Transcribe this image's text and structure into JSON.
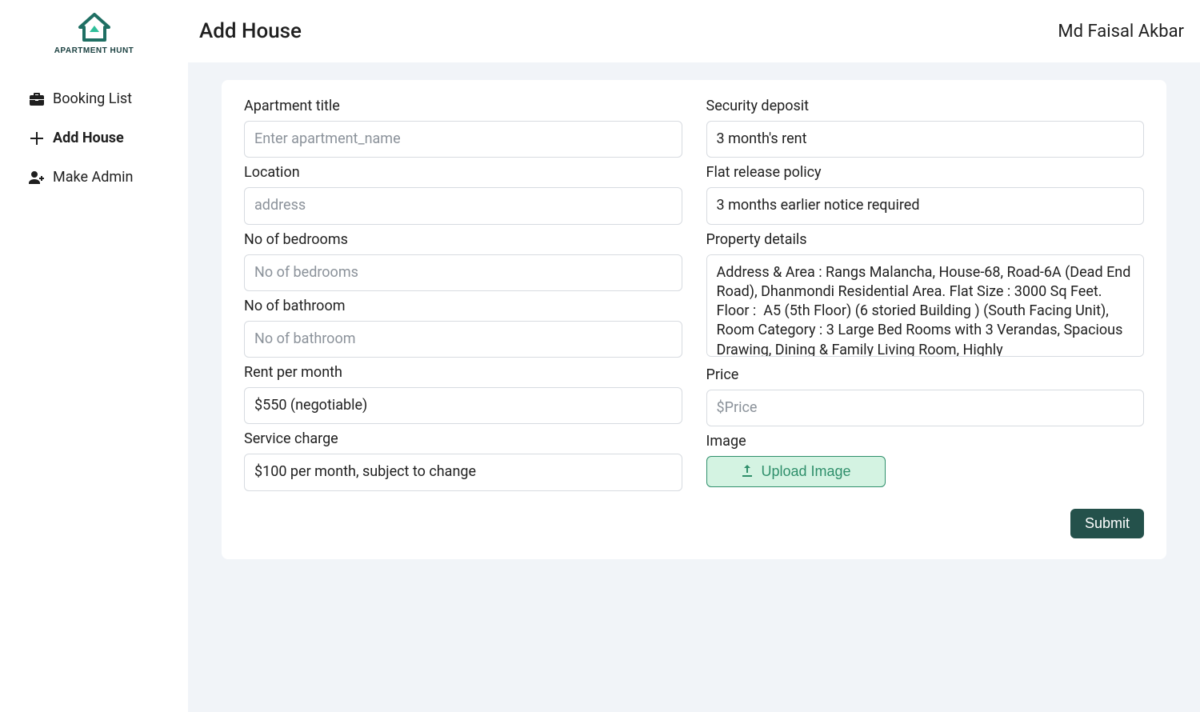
{
  "brand": {
    "name": "APARTMENT HUNT"
  },
  "header": {
    "title": "Add House",
    "user_name": "Md Faisal Akbar"
  },
  "sidebar": {
    "items": [
      {
        "label": "Booking List",
        "icon": "toolbox-icon",
        "active": false
      },
      {
        "label": "Add House",
        "icon": "plus-icon",
        "active": true
      },
      {
        "label": "Make Admin",
        "icon": "user-plus-icon",
        "active": false
      }
    ]
  },
  "form": {
    "left": {
      "title": {
        "label": "Apartment title",
        "value": "",
        "placeholder": "Enter apartment_name"
      },
      "location": {
        "label": "Location",
        "value": "",
        "placeholder": "address"
      },
      "bedrooms": {
        "label": "No of bedrooms",
        "value": "",
        "placeholder": "No of bedrooms"
      },
      "bathroom": {
        "label": "No of bathroom",
        "value": "",
        "placeholder": "No of bathroom"
      },
      "rent": {
        "label": "Rent per month",
        "value": "$550 (negotiable)",
        "placeholder": ""
      },
      "service": {
        "label": "Service charge",
        "value": "$100 per month, subject to change",
        "placeholder": ""
      }
    },
    "right": {
      "deposit": {
        "label": "Security deposit",
        "value": "3 month's rent",
        "placeholder": ""
      },
      "release": {
        "label": "Flat release policy",
        "value": "3 months earlier notice required",
        "placeholder": ""
      },
      "details": {
        "label": "Property details",
        "value": "Address & Area : Rangs Malancha, House-68, Road-6A (Dead End Road), Dhanmondi Residential Area. Flat Size : 3000 Sq Feet. Floor :  A5 (5th Floor) (6 storied Building ) (South Facing Unit), Room Category : 3 Large Bed Rooms with 3 Verandas, Spacious Drawing, Dining & Family Living Room, Highly",
        "placeholder": ""
      },
      "price": {
        "label": "Price",
        "value": "",
        "placeholder": "$Price"
      },
      "image": {
        "label": "Image",
        "button_label": "Upload Image"
      }
    },
    "submit_label": "Submit"
  }
}
